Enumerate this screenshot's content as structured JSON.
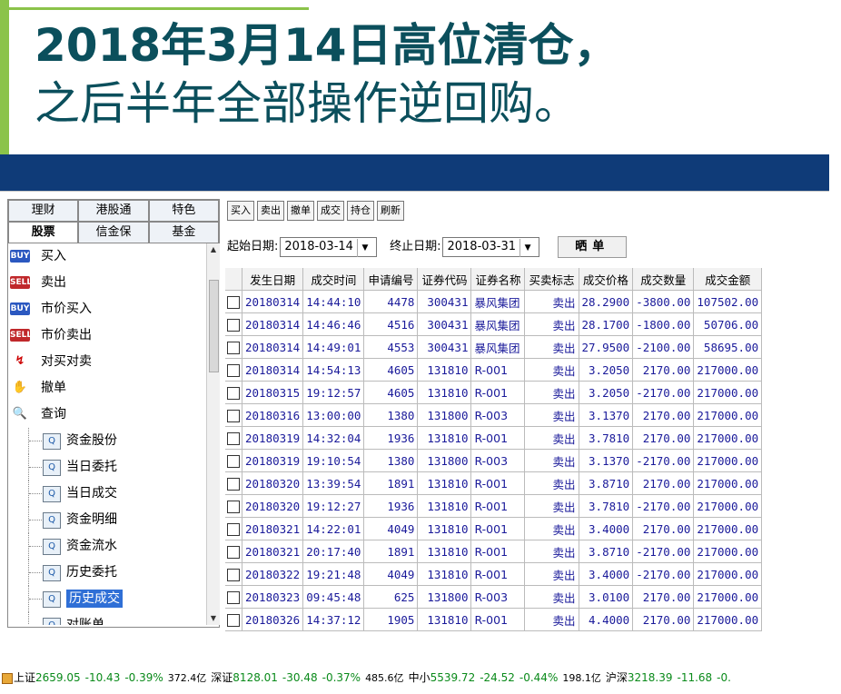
{
  "slide": {
    "title_line1": "2018年3月14日高位清仓，",
    "title_line2": "之后半年全部操作逆回购。",
    "accent_color": "#8bc34a",
    "banner_color": "#0f3b78",
    "title_color": "#0b4f5c"
  },
  "tabs": {
    "row1": [
      "理财",
      "港股通",
      "特色"
    ],
    "row2": [
      "股票",
      "信金保",
      "基金"
    ],
    "active": "股票"
  },
  "menu": [
    {
      "label": "买入",
      "icon": "buy-icon",
      "badge": "BUY"
    },
    {
      "label": "卖出",
      "icon": "sell-icon",
      "badge": "SELL"
    },
    {
      "label": "市价买入",
      "icon": "buy-icon",
      "badge": "BUY"
    },
    {
      "label": "市价卖出",
      "icon": "sell-icon",
      "badge": "SELL"
    },
    {
      "label": "对买对卖",
      "icon": "cross-trade-icon",
      "badge": "↯"
    },
    {
      "label": "撤单",
      "icon": "cancel-hand-icon",
      "badge": "✋"
    },
    {
      "label": "查询",
      "icon": "query-icon",
      "badge": "🔍"
    }
  ],
  "submenu": [
    "资金股份",
    "当日委托",
    "当日成交",
    "资金明细",
    "资金流水",
    "历史委托",
    "历史成交",
    "对账单"
  ],
  "submenu_selected": "历史成交",
  "toolbar": [
    "买入",
    "卖出",
    "撤单",
    "成交",
    "持仓",
    "刷新"
  ],
  "filters": {
    "start_label": "起始日期:",
    "start_value": "2018-03-14",
    "end_label": "终止日期:",
    "end_value": "2018-03-31",
    "query_button": "晒单"
  },
  "table": {
    "columns": [
      "发生日期",
      "成交时间",
      "申请编号",
      "证券代码",
      "证券名称",
      "买卖标志",
      "成交价格",
      "成交数量",
      "成交金额"
    ],
    "rows": [
      [
        "20180314",
        "14:44:10",
        "4478",
        "300431",
        "暴风集团",
        "卖出",
        "28.2900",
        "-3800.00",
        "107502.00"
      ],
      [
        "20180314",
        "14:46:46",
        "4516",
        "300431",
        "暴风集团",
        "卖出",
        "28.1700",
        "-1800.00",
        "50706.00"
      ],
      [
        "20180314",
        "14:49:01",
        "4553",
        "300431",
        "暴风集团",
        "卖出",
        "27.9500",
        "-2100.00",
        "58695.00"
      ],
      [
        "20180314",
        "14:54:13",
        "4605",
        "131810",
        "R-001",
        "卖出",
        "3.2050",
        "2170.00",
        "217000.00"
      ],
      [
        "20180315",
        "19:12:57",
        "4605",
        "131810",
        "R-001",
        "卖出",
        "3.2050",
        "-2170.00",
        "217000.00"
      ],
      [
        "20180316",
        "13:00:00",
        "1380",
        "131800",
        "R-003",
        "卖出",
        "3.1370",
        "2170.00",
        "217000.00"
      ],
      [
        "20180319",
        "14:32:04",
        "1936",
        "131810",
        "R-001",
        "卖出",
        "3.7810",
        "2170.00",
        "217000.00"
      ],
      [
        "20180319",
        "19:10:54",
        "1380",
        "131800",
        "R-003",
        "卖出",
        "3.1370",
        "-2170.00",
        "217000.00"
      ],
      [
        "20180320",
        "13:39:54",
        "1891",
        "131810",
        "R-001",
        "卖出",
        "3.8710",
        "2170.00",
        "217000.00"
      ],
      [
        "20180320",
        "19:12:27",
        "1936",
        "131810",
        "R-001",
        "卖出",
        "3.7810",
        "-2170.00",
        "217000.00"
      ],
      [
        "20180321",
        "14:22:01",
        "4049",
        "131810",
        "R-001",
        "卖出",
        "3.4000",
        "2170.00",
        "217000.00"
      ],
      [
        "20180321",
        "20:17:40",
        "1891",
        "131810",
        "R-001",
        "卖出",
        "3.8710",
        "-2170.00",
        "217000.00"
      ],
      [
        "20180322",
        "19:21:48",
        "4049",
        "131810",
        "R-001",
        "卖出",
        "3.4000",
        "-2170.00",
        "217000.00"
      ],
      [
        "20180323",
        "09:45:48",
        "625",
        "131800",
        "R-003",
        "卖出",
        "3.0100",
        "2170.00",
        "217000.00"
      ],
      [
        "20180326",
        "14:37:12",
        "1905",
        "131810",
        "R-001",
        "卖出",
        "4.4000",
        "2170.00",
        "217000.00"
      ]
    ]
  },
  "statusbar": [
    {
      "name": "上证",
      "value": "2659.05",
      "change": "-10.43",
      "pct": "-0.39%",
      "amount": "372.4亿"
    },
    {
      "name": "深证",
      "value": "8128.01",
      "change": "-30.48",
      "pct": "-0.37%",
      "amount": "485.6亿"
    },
    {
      "name": "中小",
      "value": "5539.72",
      "change": "-24.52",
      "pct": "-0.44%",
      "amount": "198.1亿"
    },
    {
      "name": "沪深",
      "value": "3218.39",
      "change": "-11.68",
      "pct": "-0.",
      "amount": ""
    }
  ]
}
